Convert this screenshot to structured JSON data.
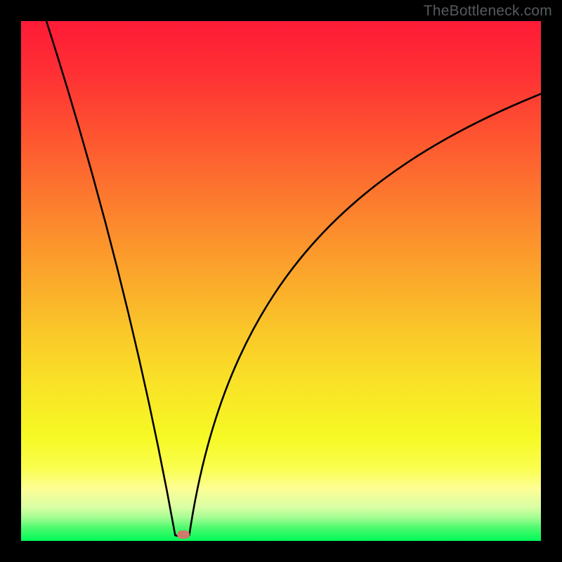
{
  "watermark": "TheBottleneck.com",
  "chart_data": {
    "type": "line",
    "title": "",
    "xlabel": "",
    "ylabel": "",
    "xlim": [
      0,
      100
    ],
    "ylim": [
      0,
      100
    ],
    "notch_x_pct": 31,
    "marker": {
      "x_pct": 31.2,
      "y_pct": 98.8,
      "color": "#cf7a6f"
    },
    "gradient_stops": [
      {
        "offset": 0.0,
        "color": "#fe1b37"
      },
      {
        "offset": 0.1,
        "color": "#fe3034"
      },
      {
        "offset": 0.2,
        "color": "#fe4e31"
      },
      {
        "offset": 0.3,
        "color": "#fd6d2f"
      },
      {
        "offset": 0.4,
        "color": "#fc8c2d"
      },
      {
        "offset": 0.5,
        "color": "#fbaa2b"
      },
      {
        "offset": 0.6,
        "color": "#fac829"
      },
      {
        "offset": 0.7,
        "color": "#f9e327"
      },
      {
        "offset": 0.8,
        "color": "#f6f924"
      },
      {
        "offset": 0.86,
        "color": "#fafe4e"
      },
      {
        "offset": 0.9,
        "color": "#fcfe96"
      },
      {
        "offset": 0.935,
        "color": "#dafea4"
      },
      {
        "offset": 0.955,
        "color": "#a3fd92"
      },
      {
        "offset": 0.975,
        "color": "#4cfa6e"
      },
      {
        "offset": 1.0,
        "color": "#00f958"
      }
    ],
    "curve": {
      "description": "Sharp V-shaped bottleneck curve with minimum near 31% of x-range; left branch rises steeply to top-left, right branch curves up more gently toward top-right.",
      "left_branch_top_x_pct": 4,
      "right_branch_top_x_pct": 100,
      "right_branch_top_y_pct": 14
    }
  }
}
